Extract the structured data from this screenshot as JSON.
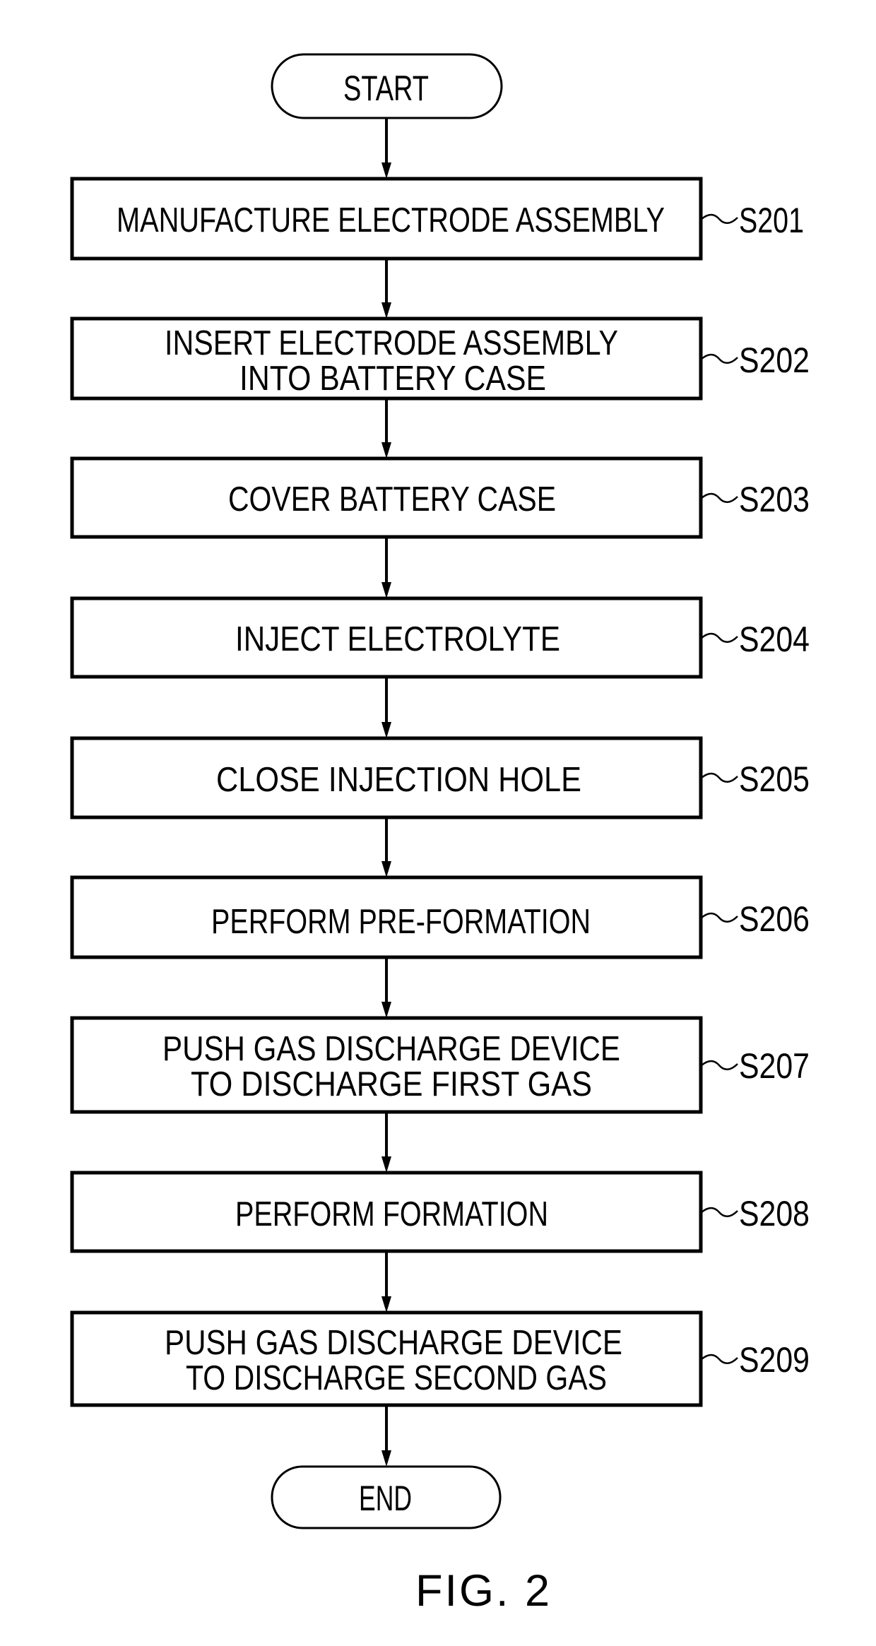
{
  "flowchart": {
    "start_label": "START",
    "end_label": "END",
    "caption": "FIG. 2",
    "steps": [
      {
        "id": "S201",
        "lines": [
          "MANUFACTURE ELECTRODE ASSEMBLY"
        ]
      },
      {
        "id": "S202",
        "lines": [
          "INSERT ELECTRODE ASSEMBLY",
          "INTO BATTERY CASE"
        ]
      },
      {
        "id": "S203",
        "lines": [
          "COVER BATTERY CASE"
        ]
      },
      {
        "id": "S204",
        "lines": [
          "INJECT ELECTROLYTE"
        ]
      },
      {
        "id": "S205",
        "lines": [
          "CLOSE INJECTION HOLE"
        ]
      },
      {
        "id": "S206",
        "lines": [
          "PERFORM PRE-FORMATION"
        ]
      },
      {
        "id": "S207",
        "lines": [
          "PUSH GAS DISCHARGE DEVICE",
          "TO DISCHARGE FIRST GAS"
        ]
      },
      {
        "id": "S208",
        "lines": [
          "PERFORM FORMATION"
        ]
      },
      {
        "id": "S209",
        "lines": [
          "PUSH GAS DISCHARGE DEVICE",
          "TO DISCHARGE SECOND GAS"
        ]
      }
    ]
  }
}
